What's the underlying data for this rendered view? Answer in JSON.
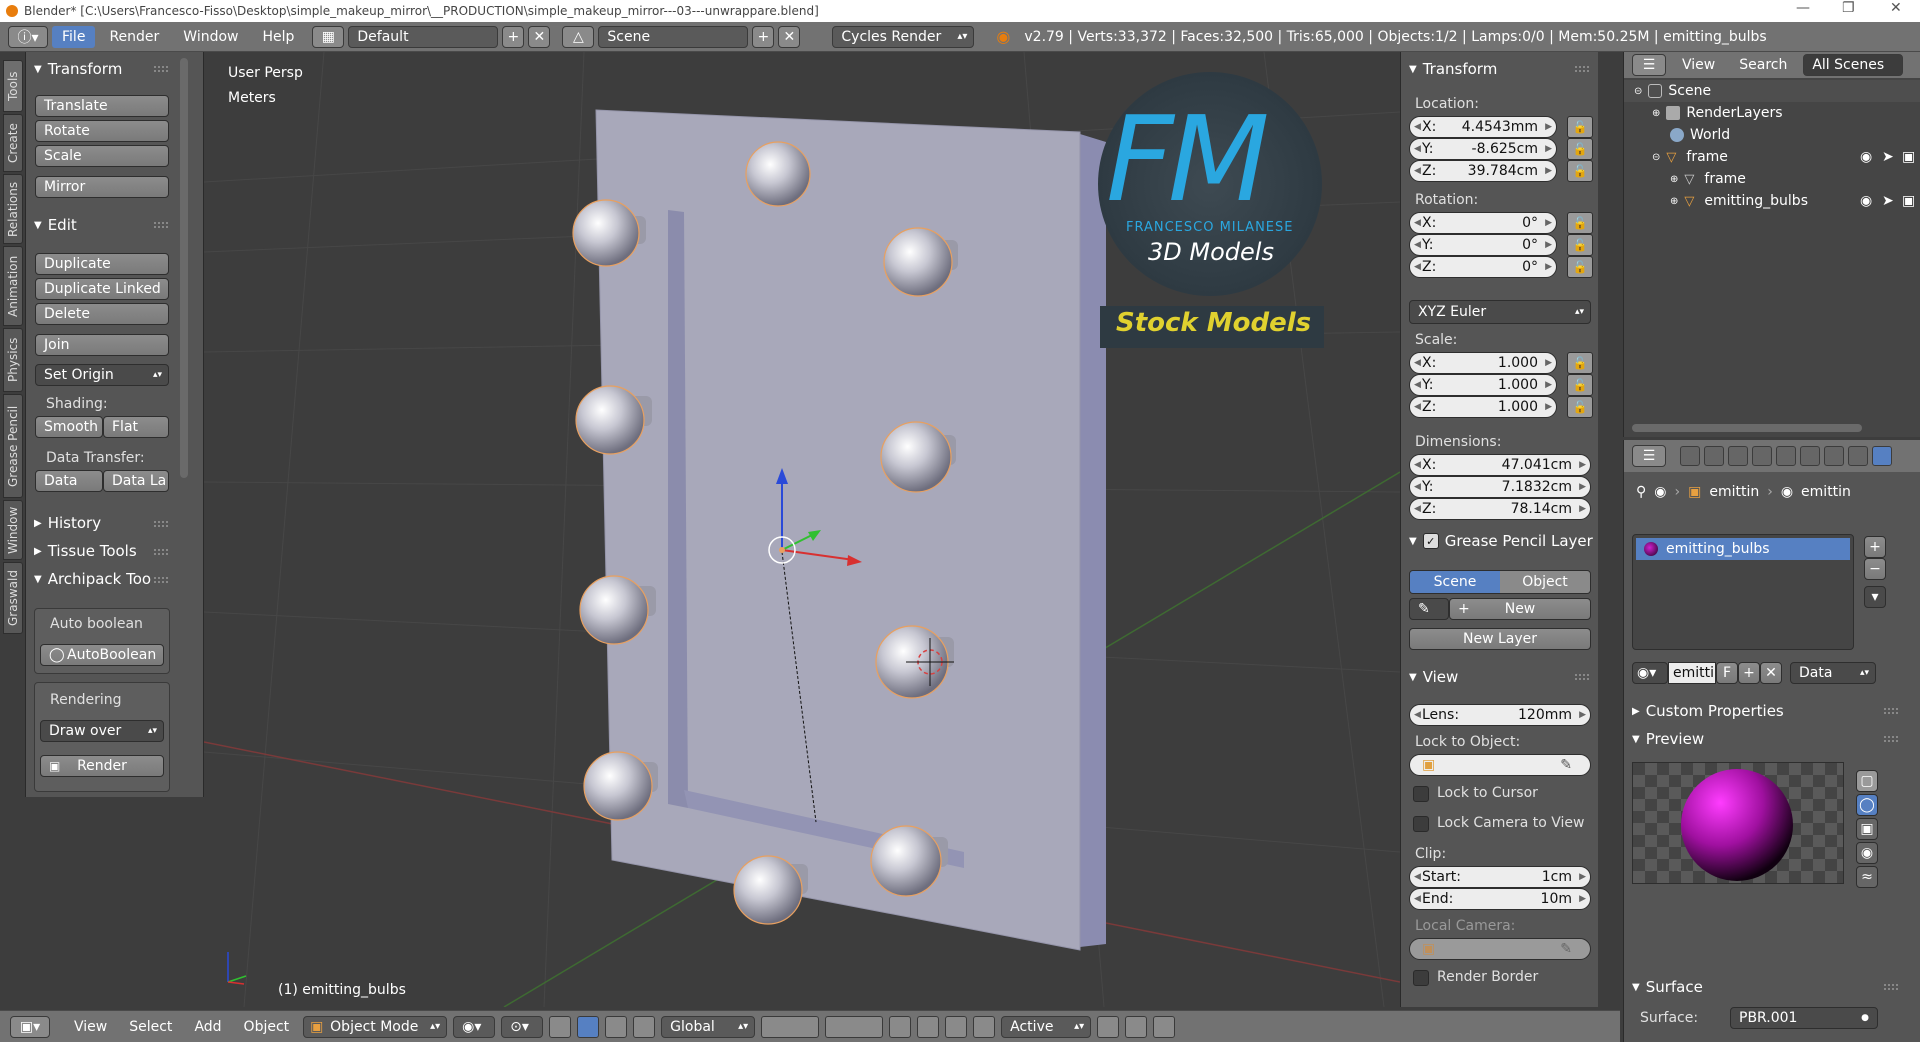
{
  "window": {
    "title": "Blender* [C:\\Users\\Francesco-Fisso\\Desktop\\simple_makeup_mirror\\__PRODUCTION\\simple_makeup_mirror---03---unwrappare.blend]"
  },
  "topbar": {
    "menus": [
      "File",
      "Render",
      "Window",
      "Help"
    ],
    "active_menu": "File",
    "layout": "Default",
    "scene": "Scene",
    "engine": "Cycles Render",
    "stats": "v2.79 | Verts:33,372 | Faces:32,500 | Tris:65,000 | Objects:1/2 | Lamps:0/0 | Mem:50.25M | emitting_bulbs"
  },
  "left_tabs": [
    "Tools",
    "Create",
    "Relations",
    "Animation",
    "Physics",
    "Grease Pencil",
    "Window",
    "Graswald"
  ],
  "toolshelf": {
    "transform_header": "Transform",
    "translate": "Translate",
    "rotate": "Rotate",
    "scale": "Scale",
    "mirror": "Mirror",
    "edit_header": "Edit",
    "duplicate": "Duplicate",
    "duplicate_linked": "Duplicate Linked",
    "delete": "Delete",
    "join": "Join",
    "set_origin": "Set Origin",
    "shading_label": "Shading:",
    "smooth": "Smooth",
    "flat": "Flat",
    "data_transfer_label": "Data Transfer:",
    "data": "Data",
    "data_la": "Data La",
    "history": "History",
    "tissue_tools": "Tissue Tools",
    "archipack_tools": "Archipack Too",
    "auto_boolean_label": "Auto boolean",
    "auto_boolean_btn": "AutoBoolean",
    "rendering_label": "Rendering",
    "draw_over": "Draw over",
    "render": "Render"
  },
  "viewport": {
    "view_name": "User Persp",
    "units": "Meters",
    "object_label": "(1) emitting_bulbs",
    "logo_letters": "FM",
    "logo_name": "FRANCESCO MILANESE",
    "logo_sub": "3D Models",
    "stock_models": "Stock Models"
  },
  "npanel": {
    "transform_header": "Transform",
    "location_label": "Location:",
    "location": [
      {
        "k": "X:",
        "v": "4.4543mm"
      },
      {
        "k": "Y:",
        "v": "-8.625cm"
      },
      {
        "k": "Z:",
        "v": "39.784cm"
      }
    ],
    "rotation_label": "Rotation:",
    "rotation": [
      {
        "k": "X:",
        "v": "0°"
      },
      {
        "k": "Y:",
        "v": "0°"
      },
      {
        "k": "Z:",
        "v": "0°"
      }
    ],
    "rotation_mode": "XYZ Euler",
    "scale_label": "Scale:",
    "scale": [
      {
        "k": "X:",
        "v": "1.000"
      },
      {
        "k": "Y:",
        "v": "1.000"
      },
      {
        "k": "Z:",
        "v": "1.000"
      }
    ],
    "dimensions_label": "Dimensions:",
    "dimensions": [
      {
        "k": "X:",
        "v": "47.041cm"
      },
      {
        "k": "Y:",
        "v": "7.1832cm"
      },
      {
        "k": "Z:",
        "v": "78.14cm"
      }
    ],
    "grease_header": "Grease Pencil Layer",
    "scene_tab": "Scene",
    "object_tab": "Object",
    "new": "New",
    "new_layer": "New Layer",
    "view_header": "View",
    "lens_label": "Lens:",
    "lens_value": "120mm",
    "lock_to_object": "Lock to Object:",
    "lock_to_cursor": "Lock to Cursor",
    "lock_camera": "Lock Camera to View",
    "clip_label": "Clip:",
    "clip_start_k": "Start:",
    "clip_start_v": "1cm",
    "clip_end_k": "End:",
    "clip_end_v": "10m",
    "local_camera": "Local Camera:",
    "render_border": "Render Border"
  },
  "outliner": {
    "view": "View",
    "search": "Search",
    "all_scenes": "All Scenes",
    "rows": [
      "Scene",
      "RenderLayers",
      "World",
      "frame",
      "frame",
      "emitting_bulbs"
    ]
  },
  "properties": {
    "crumb1": "emittin",
    "crumb2": "emittin",
    "material_slot": "emitting_bulbs",
    "mat_name": "emitti",
    "mat_f": "F",
    "data_dd": "Data",
    "custom_properties": "Custom Properties",
    "preview": "Preview",
    "surface_header": "Surface",
    "surface_label": "Surface:",
    "surface_value": "PBR.001"
  },
  "bottombar": {
    "view": "View",
    "select": "Select",
    "add": "Add",
    "object": "Object",
    "mode": "Object Mode",
    "orientation": "Global",
    "pivot": "Active"
  },
  "colors": {
    "accent": "#5680c2",
    "panel": "#555555",
    "viewport": "#3d3d3d",
    "header": "#727272",
    "stock_text": "#e0d12f",
    "logo_blue": "#2aa7e0"
  }
}
